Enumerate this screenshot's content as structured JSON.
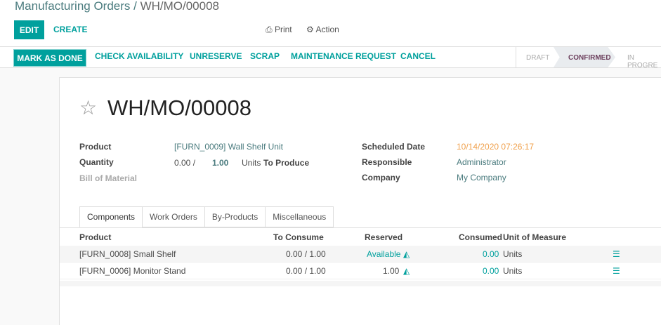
{
  "breadcrumb": {
    "parent": "Manufacturing Orders",
    "current": "WH/MO/00008"
  },
  "toolbar": {
    "edit": "EDIT",
    "create": "CREATE",
    "print": "Print",
    "action": "Action"
  },
  "statusbar": {
    "buttons": [
      "MARK AS DONE",
      "CHECK AVAILABILITY",
      "UNRESERVE",
      "SCRAP",
      "MAINTENANCE REQUEST",
      "CANCEL"
    ],
    "stages": [
      "DRAFT",
      "CONFIRMED",
      "IN PROGRE"
    ],
    "active_stage": "CONFIRMED"
  },
  "form": {
    "title": "WH/MO/00008",
    "product_label": "Product",
    "product": "[FURN_0009] Wall Shelf Unit",
    "quantity_label": "Quantity",
    "qty_done": "0.00 /",
    "qty": "1.00",
    "uom": "Units",
    "to_produce": "To Produce",
    "bom_label": "Bill of Material",
    "scheduled_label": "Scheduled Date",
    "scheduled": "10/14/2020 07:26:17",
    "responsible_label": "Responsible",
    "responsible": "Administrator",
    "company_label": "Company",
    "company": "My Company"
  },
  "tabs": [
    "Components",
    "Work Orders",
    "By-Products",
    "Miscellaneous"
  ],
  "table": {
    "headers": [
      "Product",
      "To Consume",
      "Reserved",
      "Consumed",
      "Unit of Measure"
    ],
    "rows": [
      {
        "product": "[FURN_0008] Small Shelf",
        "to_consume": "0.00 / 1.00",
        "reserved": "Available",
        "consumed": "0.00",
        "uom": "Units"
      },
      {
        "product": "[FURN_0006] Monitor Stand",
        "to_consume": "0.00 / 1.00",
        "reserved": "1.00",
        "consumed": "0.00",
        "uom": "Units"
      }
    ]
  },
  "colors": {
    "accent": "#00a09d",
    "date": "#f0a04b"
  }
}
